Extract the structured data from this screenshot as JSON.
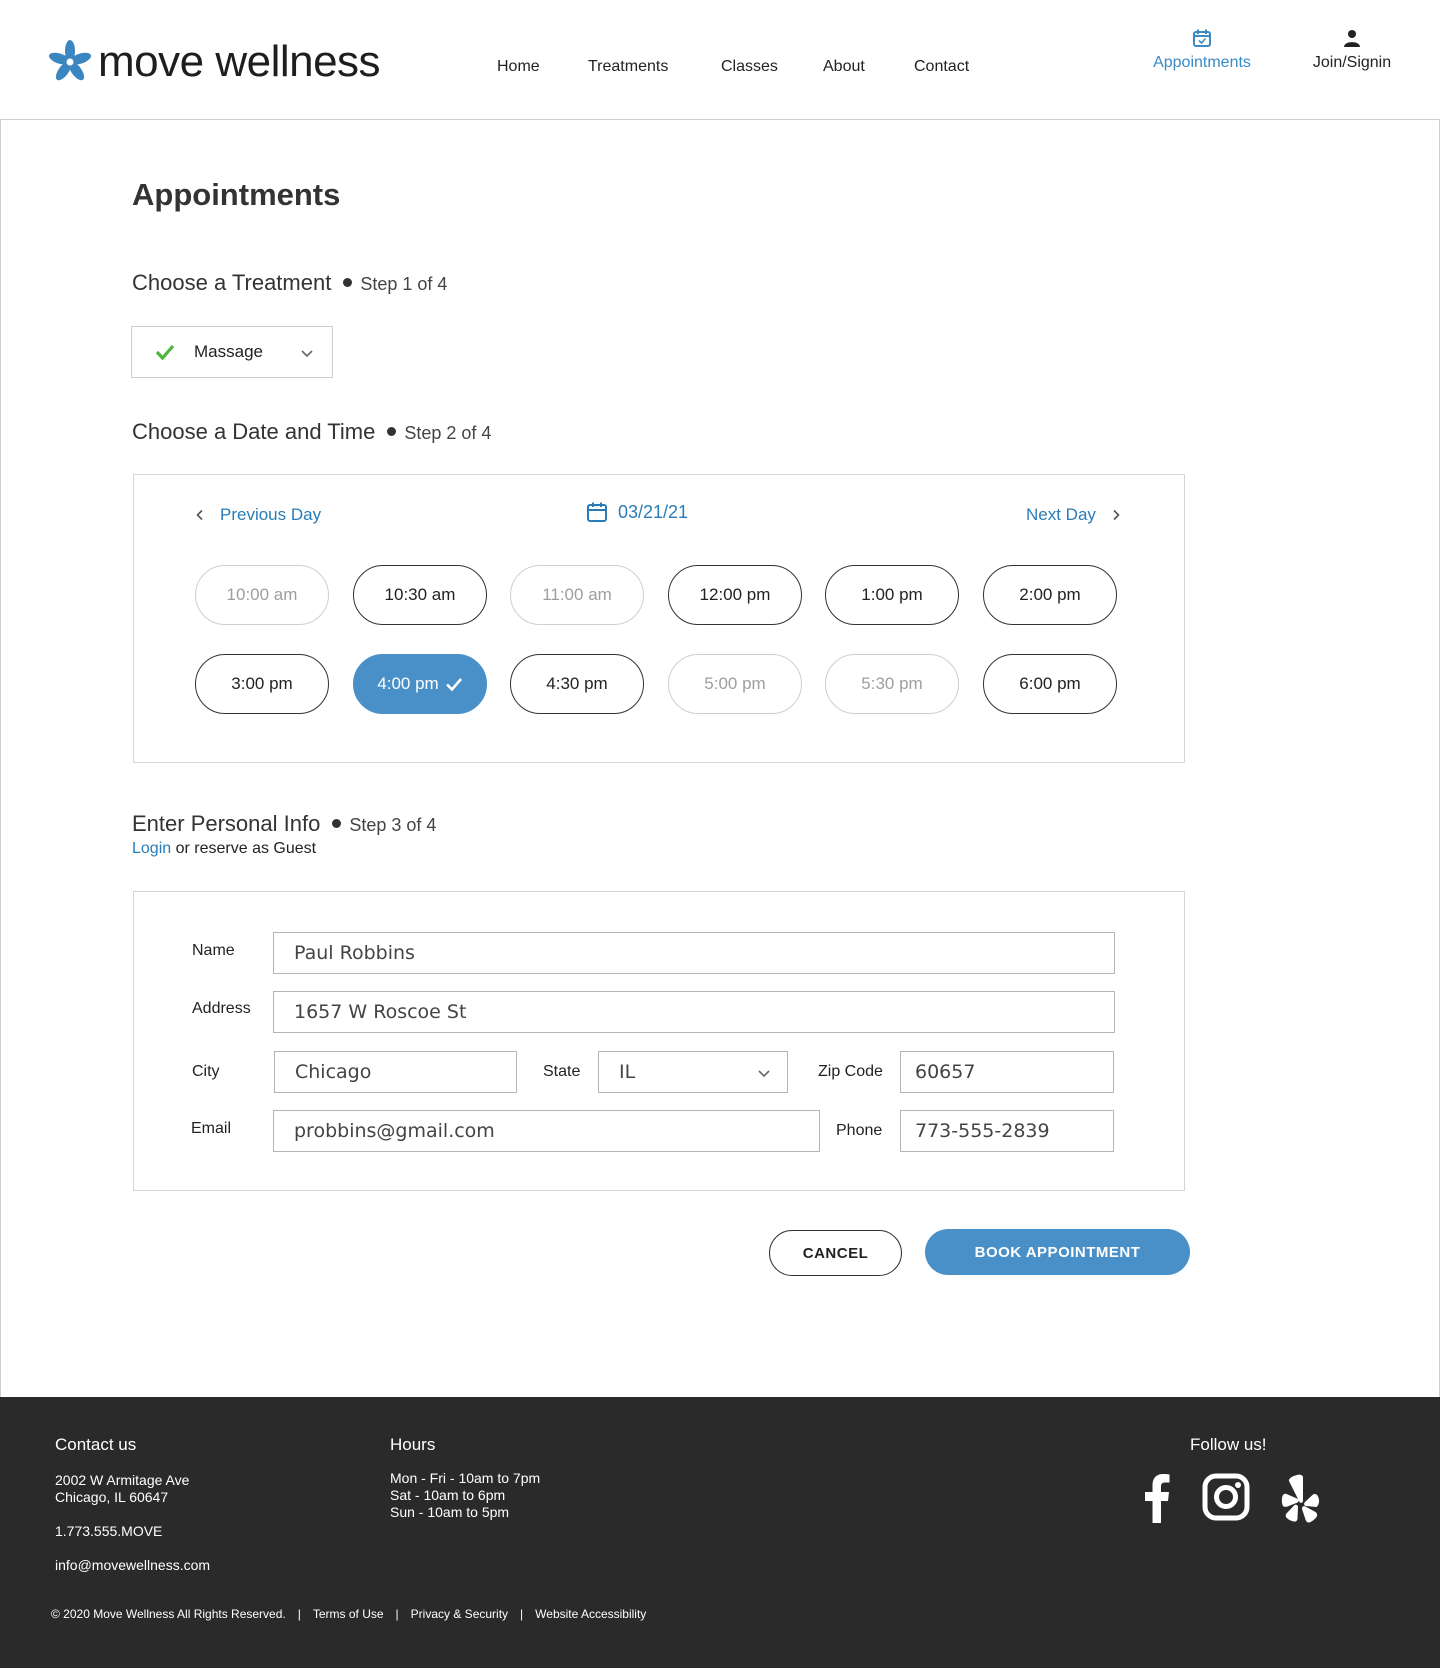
{
  "brand": {
    "name": "move wellness",
    "accent": "#4a90c8",
    "link_color": "#2a7cb8"
  },
  "nav": {
    "items": [
      {
        "label": "Home"
      },
      {
        "label": "Treatments"
      },
      {
        "label": "Classes"
      },
      {
        "label": "About"
      },
      {
        "label": "Contact"
      }
    ],
    "appointments": {
      "label": "Appointments",
      "icon": "calendar-icon"
    },
    "join": {
      "label": "Join/Signin",
      "icon": "user-icon"
    }
  },
  "page": {
    "title": "Appointments"
  },
  "step1": {
    "title": "Choose a Treatment",
    "step": "Step 1 of 4",
    "treatment_value": "Massage"
  },
  "step2": {
    "title": "Choose a Date and Time",
    "step": "Step 2 of 4",
    "prev_label": "Previous Day",
    "next_label": "Next Day",
    "date": "03/21/21",
    "slots": [
      {
        "time": "10:00 am",
        "state": "disabled"
      },
      {
        "time": "10:30 am",
        "state": "available"
      },
      {
        "time": "11:00 am",
        "state": "disabled"
      },
      {
        "time": "12:00 pm",
        "state": "available"
      },
      {
        "time": "1:00 pm",
        "state": "available"
      },
      {
        "time": "2:00 pm",
        "state": "available"
      },
      {
        "time": "3:00 pm",
        "state": "available"
      },
      {
        "time": "4:00 pm",
        "state": "selected"
      },
      {
        "time": "4:30 pm",
        "state": "available"
      },
      {
        "time": "5:00 pm",
        "state": "disabled"
      },
      {
        "time": "5:30 pm",
        "state": "disabled"
      },
      {
        "time": "6:00 pm",
        "state": "available"
      }
    ]
  },
  "step3": {
    "title": "Enter Personal Info",
    "step": "Step 3 of 4",
    "login_link": "Login",
    "guest_text": " or reserve as Guest",
    "fields": {
      "name": {
        "label": "Name",
        "value": "Paul Robbins"
      },
      "address": {
        "label": "Address",
        "value": "1657 W Roscoe St"
      },
      "city": {
        "label": "City",
        "value": "Chicago"
      },
      "state": {
        "label": "State",
        "value": "IL"
      },
      "zip": {
        "label": "Zip Code",
        "value": "60657"
      },
      "email": {
        "label": "Email",
        "value": "probbins@gmail.com"
      },
      "phone": {
        "label": "Phone",
        "value": "773-555-2839"
      }
    }
  },
  "actions": {
    "cancel": "CANCEL",
    "book": "BOOK APPOINTMENT"
  },
  "footer": {
    "contact_heading": "Contact us",
    "address_line1": "2002 W Armitage Ave",
    "address_line2": "Chicago, IL 60647",
    "phone": "1.773.555.MOVE",
    "email": "info@movewellness.com",
    "hours_heading": "Hours",
    "hours": [
      "Mon - Fri - 10am to 7pm",
      "Sat - 10am to 6pm",
      "Sun - 10am to 5pm"
    ],
    "follow_heading": "Follow us!",
    "social": [
      "facebook-icon",
      "instagram-icon",
      "yelp-icon"
    ],
    "copyright": "© 2020 Move Wellness All Rights Reserved.",
    "sep": "|",
    "links": [
      "Terms of Use",
      "Privacy & Security",
      "Website Accessibility"
    ]
  }
}
